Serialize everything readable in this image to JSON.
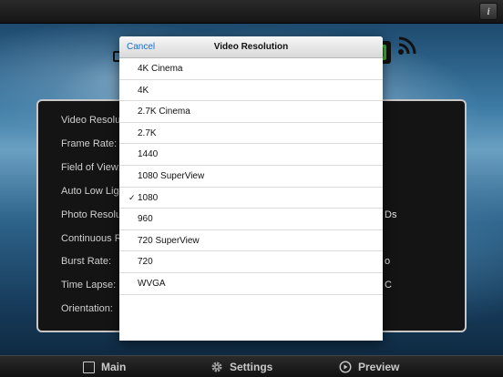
{
  "header": {
    "info_button": "i"
  },
  "settings_labels": [
    "Video Resolu",
    "Frame Rate:",
    "Field of View:",
    "Auto Low Ligh",
    "Photo Resolut",
    "Continuous R",
    "Burst Rate:",
    "Time Lapse:",
    "Orientation:"
  ],
  "settings_values": {
    "photo_resolution": "Ds",
    "burst_rate": "o",
    "time_lapse": "C"
  },
  "picker": {
    "cancel_label": "Cancel",
    "title": "Video Resolution",
    "selected": "1080",
    "options": [
      "4K Cinema",
      "4K",
      "2.7K Cinema",
      "2.7K",
      "1440",
      "1080 SuperView",
      "1080",
      "960",
      "720 SuperView",
      "720",
      "WVGA"
    ],
    "check_mark": "✓"
  },
  "tabs": [
    {
      "label": "Main",
      "icon": "square-icon"
    },
    {
      "label": "Settings",
      "icon": "gear-icon"
    },
    {
      "label": "Preview",
      "icon": "play-circle-icon"
    }
  ],
  "colors": {
    "accent": "#1c6dd0",
    "camera_status_green": "#3fae3a"
  }
}
